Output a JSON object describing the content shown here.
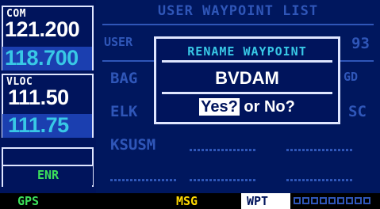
{
  "com": {
    "label": "COM",
    "active": "121.200",
    "standby": "118.700"
  },
  "vloc": {
    "label": "VLOC",
    "active": "111.50",
    "standby": "111.75"
  },
  "mode": "ENR",
  "page_title": "USER WAYPOINT LIST",
  "background_list": {
    "header_label": "USER",
    "header_value": "93",
    "rows": [
      {
        "name": "BAG",
        "right": "GD"
      },
      {
        "name": "ELK",
        "right": "SC"
      },
      {
        "name": "KSUSM",
        "right": ""
      }
    ]
  },
  "popup": {
    "title": "RENAME WAYPOINT",
    "name": "BVDAM",
    "yes": "Yes?",
    "or": "or",
    "no": "No?"
  },
  "status_bar": {
    "gps": "GPS",
    "msg": "MSG",
    "wpt": "WPT"
  },
  "colors": {
    "cyan": "#38c8e6",
    "green": "#3ce05a",
    "yellow": "#ffd800",
    "background": "#00175e"
  }
}
